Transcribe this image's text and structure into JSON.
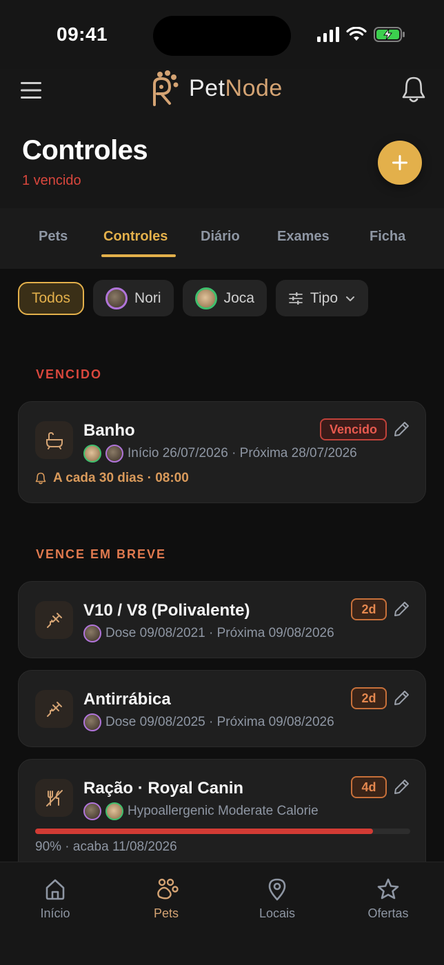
{
  "status_bar": {
    "time": "09:41"
  },
  "header": {
    "logo_part1": "Pet",
    "logo_part2": "Node"
  },
  "page": {
    "title": "Controles",
    "subtitle": "1 vencido"
  },
  "tabs": [
    {
      "label": "Pets",
      "active": false
    },
    {
      "label": "Controles",
      "active": true
    },
    {
      "label": "Diário",
      "active": false
    },
    {
      "label": "Exames",
      "active": false
    },
    {
      "label": "Ficha",
      "active": false
    }
  ],
  "filters": {
    "all": "Todos",
    "pet1": "Nori",
    "pet2": "Joca",
    "type": "Tipo"
  },
  "sections": {
    "overdue": "VENCIDO",
    "soon": "VENCE EM BREVE"
  },
  "cards": [
    {
      "title": "Banho",
      "icon": "bathtub-icon",
      "meta": "Início 26/07/2026 · Próxima 28/07/2026",
      "badge": "Vencido",
      "reminder": "A cada 30 dias · 08:00"
    },
    {
      "title": "V10 / V8 (Polivalente)",
      "icon": "syringe-icon",
      "meta": "Dose 09/08/2021 · Próxima 09/08/2026",
      "badge": "2d"
    },
    {
      "title": "Antirrábica",
      "icon": "syringe-icon",
      "meta": "Dose 09/08/2025 · Próxima 09/08/2026",
      "badge": "2d"
    },
    {
      "title": "Ração · Royal Canin",
      "icon": "food-icon",
      "meta": "Hypoallergenic Moderate Calorie",
      "badge": "4d",
      "progress": 0.9,
      "progress_label": "90% · acaba 11/08/2026"
    }
  ],
  "bottom_nav": [
    {
      "label": "Início",
      "icon": "home-icon",
      "active": false
    },
    {
      "label": "Pets",
      "icon": "paw-icon",
      "active": true
    },
    {
      "label": "Locais",
      "icon": "location-pin-icon",
      "active": false
    },
    {
      "label": "Ofertas",
      "icon": "star-icon",
      "active": false
    }
  ],
  "colors": {
    "accent": "#e3b04b",
    "overdue": "#d9473d",
    "soon": "#e07a4f",
    "progress": "#d23b34"
  }
}
